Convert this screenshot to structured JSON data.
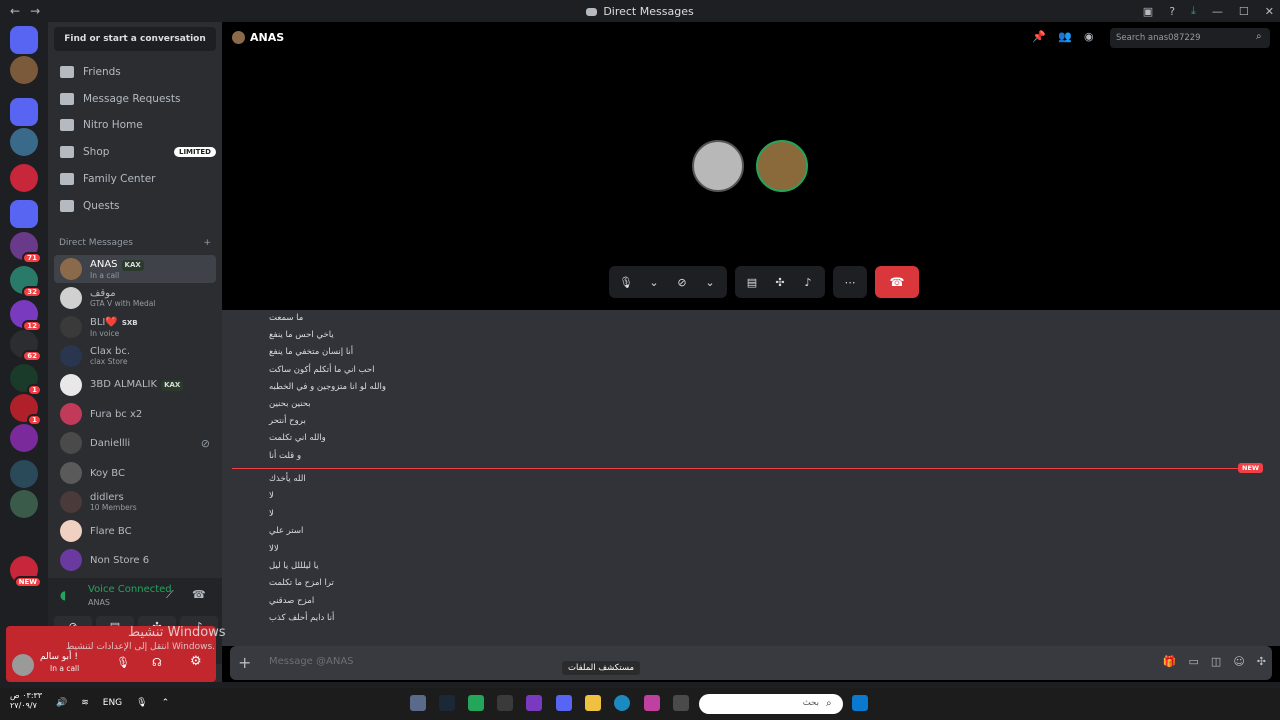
{
  "window": {
    "title": "Direct Messages"
  },
  "sidebar": {
    "find_placeholder": "Find or start a conversation",
    "nav": [
      {
        "label": "Friends",
        "icon": "friends-icon"
      },
      {
        "label": "Message Requests",
        "icon": "mail-icon"
      },
      {
        "label": "Nitro Home",
        "icon": "nitro-icon"
      },
      {
        "label": "Shop",
        "icon": "shop-icon",
        "badge": "LIMITED"
      },
      {
        "label": "Family Center",
        "icon": "family-icon"
      },
      {
        "label": "Quests",
        "icon": "quests-icon"
      }
    ],
    "dm_header": "Direct Messages",
    "dm_add": "+",
    "dms": [
      {
        "name": "ANAS",
        "tag": "KAX",
        "sub": "In a call",
        "color": "#8a6a4a"
      },
      {
        "name": "موقف",
        "tag": "",
        "sub": "GTA V with Medal",
        "color": "#d0d0d0"
      },
      {
        "name": "BLI❤️",
        "tag": "SXB",
        "sub": "In voice",
        "color": "#3a3a3a"
      },
      {
        "name": "Clax bc.",
        "tag": "",
        "sub": "clax Store",
        "color": "#2a3550"
      },
      {
        "name": "3BD ALMALIK",
        "tag": "KAX",
        "sub": "",
        "color": "#e8e8e8"
      },
      {
        "name": "Fura bc x2",
        "tag": "",
        "sub": "",
        "color": "#c23a5a"
      },
      {
        "name": "Daniellli",
        "tag": "",
        "sub": "",
        "color": "#4a4a4a"
      },
      {
        "name": "Koy BC",
        "tag": "",
        "sub": "",
        "color": "#5a5a5a"
      },
      {
        "name": "didlers",
        "tag": "",
        "sub": "10 Members",
        "color": "#4a3a3a"
      },
      {
        "name": "Flare BC",
        "tag": "",
        "sub": "",
        "color": "#f0d0c0"
      },
      {
        "name": "Non Store 6",
        "tag": "",
        "sub": "",
        "color": "#6a3aa0"
      }
    ],
    "voice": {
      "title": "Voice Connected",
      "channel": "ANAS"
    },
    "user": {
      "name": "أبو سالم !",
      "status": "In a call"
    }
  },
  "servers": [
    {
      "badge": "",
      "color": "#5865f2"
    },
    {
      "badge": "",
      "color": "#7a5a3a"
    },
    {
      "badge": "",
      "color": "#5865f2"
    },
    {
      "badge": "",
      "color": "#3a6a8a"
    },
    {
      "badge": "",
      "color": "#c8263a"
    },
    {
      "badge": "",
      "color": "#5865f2"
    },
    {
      "badge": "71",
      "color": "#6a3a8a"
    },
    {
      "badge": "32",
      "color": "#2a7a6a"
    },
    {
      "badge": "12",
      "color": "#7a3ac0"
    },
    {
      "badge": "62",
      "color": "#2b2d31"
    },
    {
      "badge": "1",
      "color": "#1a3a2a"
    },
    {
      "badge": "1",
      "color": "#b0202a"
    },
    {
      "badge": "",
      "color": "#7a2a9a"
    },
    {
      "badge": "",
      "color": "#2a4a5a"
    },
    {
      "badge": "",
      "color": "#3a5a4a"
    },
    {
      "badge": "",
      "color": "#1e1f22"
    },
    {
      "badge": "NEW",
      "color": "#c8263a"
    }
  ],
  "call": {
    "header_name": "ANAS",
    "search_placeholder": "Search anas087229"
  },
  "messages_before": [
    "ما سمعت",
    "ياخي احس ما ينفع",
    "أنا إنسان متخفي ما ينفع",
    "احب اني ما أتكلم أكون ساكت",
    "والله لو انا متزوجين و في الخطبه",
    "بحنين بحنين",
    "بروح أنتحر",
    "والله اني تكلمت",
    "و قلت أنا"
  ],
  "new_label": "NEW",
  "messages_after": [
    "الله يأخذك",
    "لا",
    "لا",
    "استر علي",
    "لالا",
    "يا ليلللل يا ليل",
    "ترا امزح ما تكلمت",
    "امزح صدقني",
    "أنا دايم أحلف كذب"
  ],
  "composer": {
    "placeholder": "Message @ANAS"
  },
  "watermark": {
    "line1": "تنشيط Windows",
    "line2": "انتقل إلى الإعدادات لتنشيط Windows."
  },
  "tooltip": "مستكشف الملفات",
  "taskbar": {
    "time": "٠٣:٣٣ ص",
    "date": "٢٧/٠٩/٧",
    "lang": "ENG",
    "search_placeholder": "بحث"
  }
}
